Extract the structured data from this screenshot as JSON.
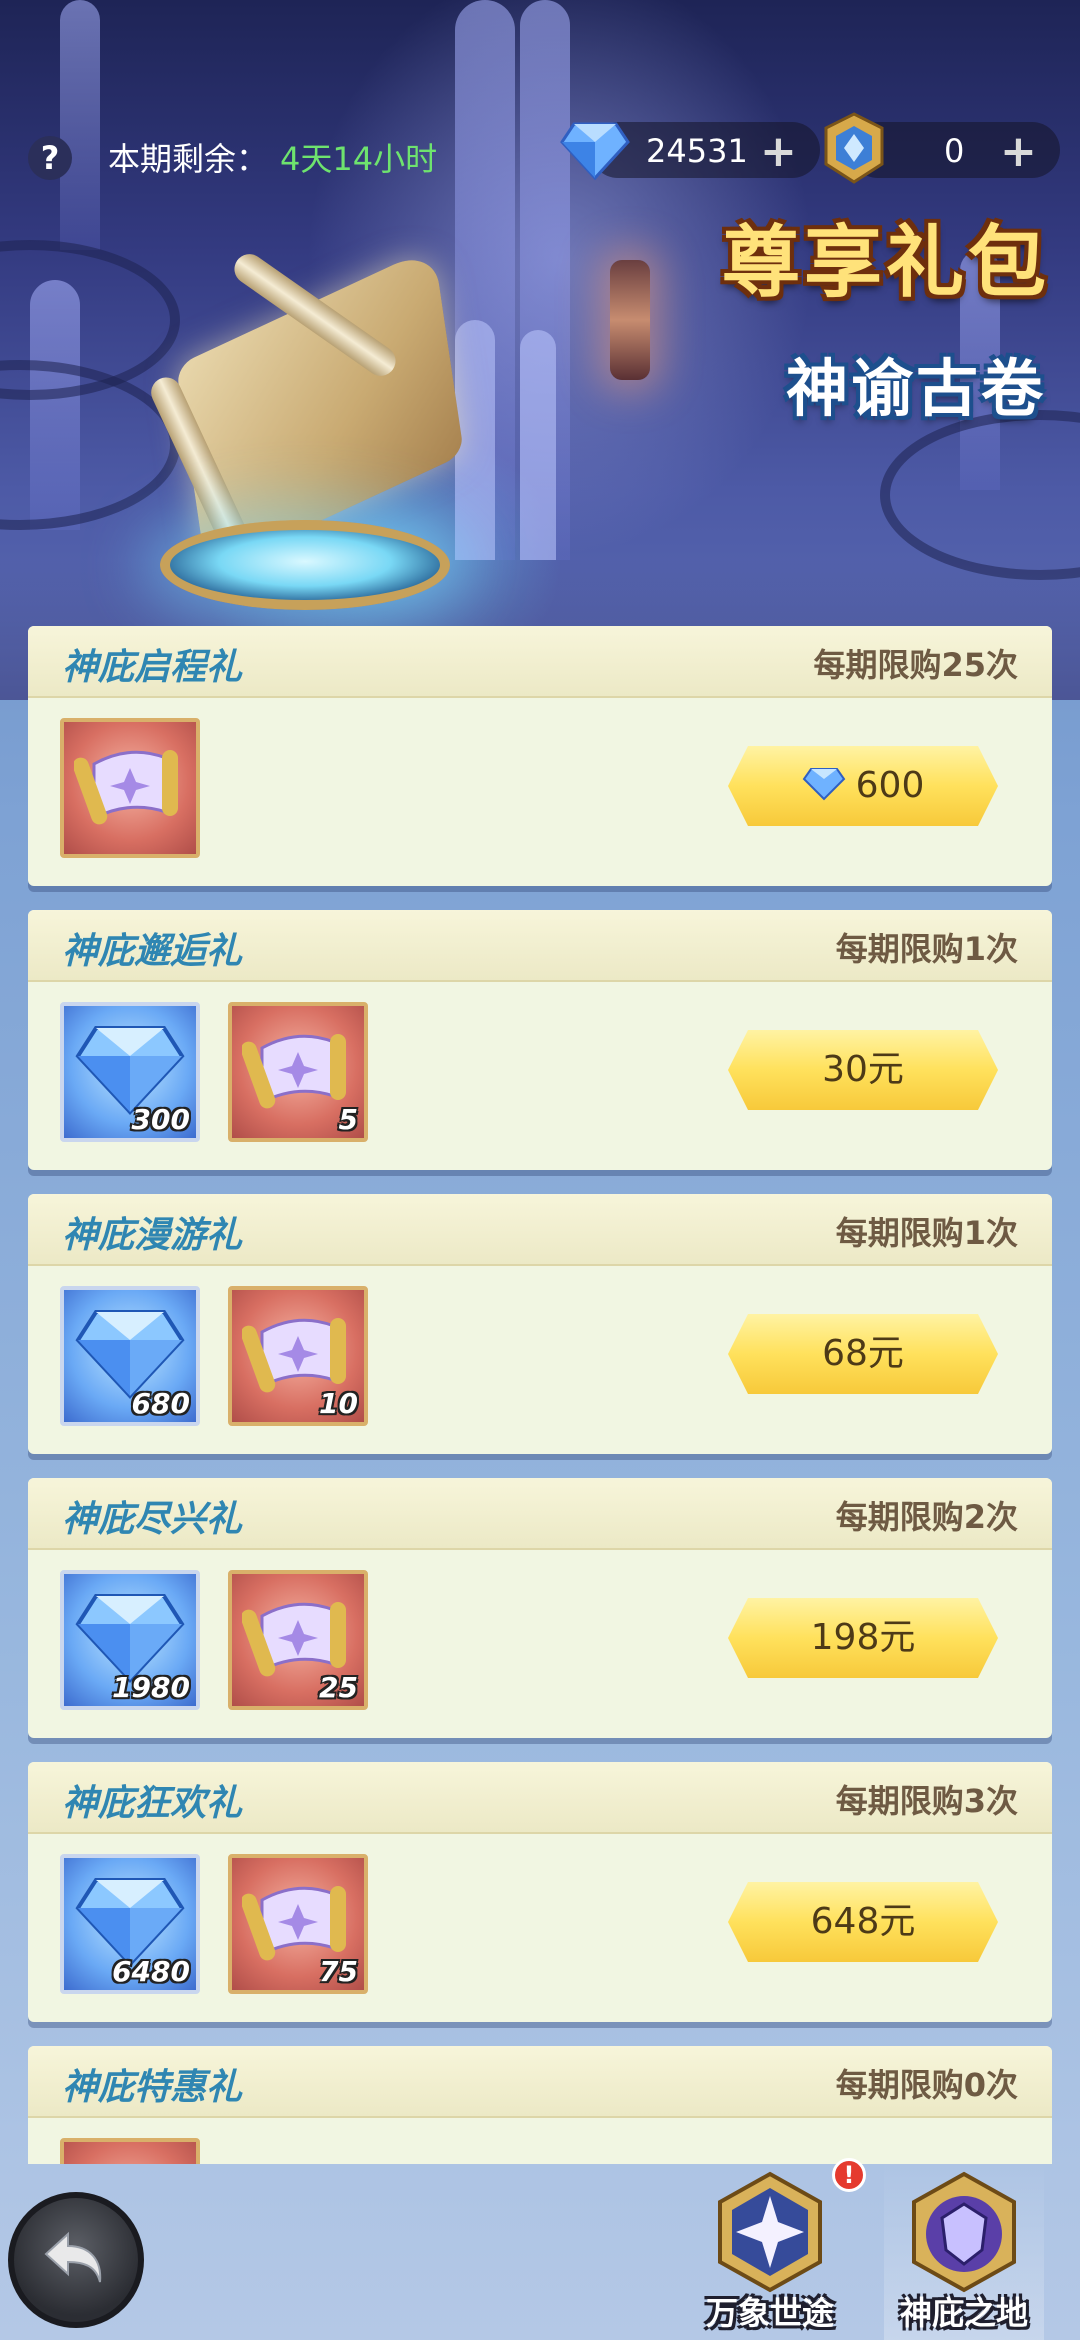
{
  "header": {
    "remaining_label": "本期剩余：",
    "remaining_value": "4天14小时",
    "diamond_count": "24531",
    "token_count": "0",
    "plus_symbol": "+",
    "help_symbol": "?"
  },
  "banner": {
    "title": "尊享礼包",
    "subtitle": "神谕古卷"
  },
  "packs": [
    {
      "name": "神庇启程礼",
      "limit": "每期限购25次",
      "price": "600",
      "price_type": "diamond",
      "items": [
        {
          "type": "scroll",
          "qty": ""
        }
      ]
    },
    {
      "name": "神庇邂逅礼",
      "limit": "每期限购1次",
      "price": "30元",
      "price_type": "cash",
      "items": [
        {
          "type": "diamond",
          "qty": "300"
        },
        {
          "type": "scroll",
          "qty": "5"
        }
      ]
    },
    {
      "name": "神庇漫游礼",
      "limit": "每期限购1次",
      "price": "68元",
      "price_type": "cash",
      "items": [
        {
          "type": "diamond",
          "qty": "680"
        },
        {
          "type": "scroll",
          "qty": "10"
        }
      ]
    },
    {
      "name": "神庇尽兴礼",
      "limit": "每期限购2次",
      "price": "198元",
      "price_type": "cash",
      "items": [
        {
          "type": "diamond",
          "qty": "1980"
        },
        {
          "type": "scroll",
          "qty": "25"
        }
      ]
    },
    {
      "name": "神庇狂欢礼",
      "limit": "每期限购3次",
      "price": "648元",
      "price_type": "cash",
      "items": [
        {
          "type": "diamond",
          "qty": "6480"
        },
        {
          "type": "scroll",
          "qty": "75"
        }
      ]
    },
    {
      "name": "神庇特惠礼",
      "limit": "每期限购0次",
      "price": "",
      "price_type": "cash",
      "items": [
        {
          "type": "scroll",
          "qty": ""
        }
      ]
    }
  ],
  "bottom_nav": {
    "tabs": [
      {
        "label": "万象世途",
        "icon": "star-emblem-icon",
        "selected": false,
        "badge": "!"
      },
      {
        "label": "神庇之地",
        "icon": "shield-emblem-icon",
        "selected": true
      }
    ]
  },
  "colors": {
    "pack_title": "#2f86b2",
    "limit_text": "#6e5a43",
    "price_button": "#ffe15c",
    "remaining_value": "#6ee36e",
    "banner_title": "#ffe27a"
  }
}
